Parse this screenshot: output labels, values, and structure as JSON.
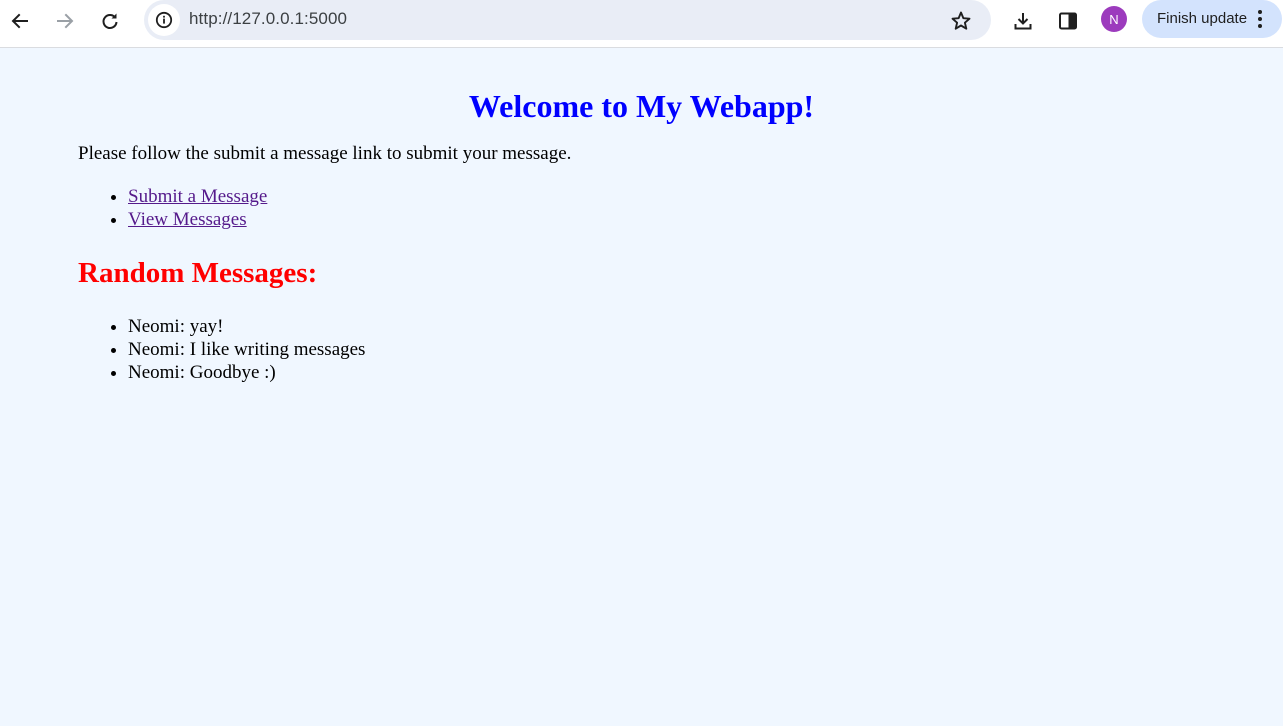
{
  "browser": {
    "url": "http://127.0.0.1:5000",
    "profile_initial": "N",
    "update_button_label": "Finish update",
    "icons": {
      "back": "arrow-left-icon",
      "forward": "arrow-right-icon",
      "reload": "reload-icon",
      "site_info": "info-icon",
      "bookmark": "star-icon",
      "downloads": "download-icon",
      "side_panel": "side-panel-icon",
      "menu": "kebab-menu-icon"
    },
    "colors": {
      "omnibox": "#e9edf6",
      "avatar": "#9c3bbd",
      "update_button": "#d3e3fd"
    }
  },
  "page": {
    "title": "Welcome to My Webapp!",
    "intro": "Please follow the submit a message link to submit your message.",
    "links": [
      {
        "label": "Submit a Message"
      },
      {
        "label": "View Messages"
      }
    ],
    "section_title": "Random Messages:",
    "messages": [
      "Neomi: yay!",
      "Neomi: I like writing messages",
      "Neomi: Goodbye :)"
    ],
    "colors": {
      "background": "#f0f7ff",
      "title": "#0000ff",
      "section_title": "#ff0000",
      "link": "#551a8b"
    }
  }
}
